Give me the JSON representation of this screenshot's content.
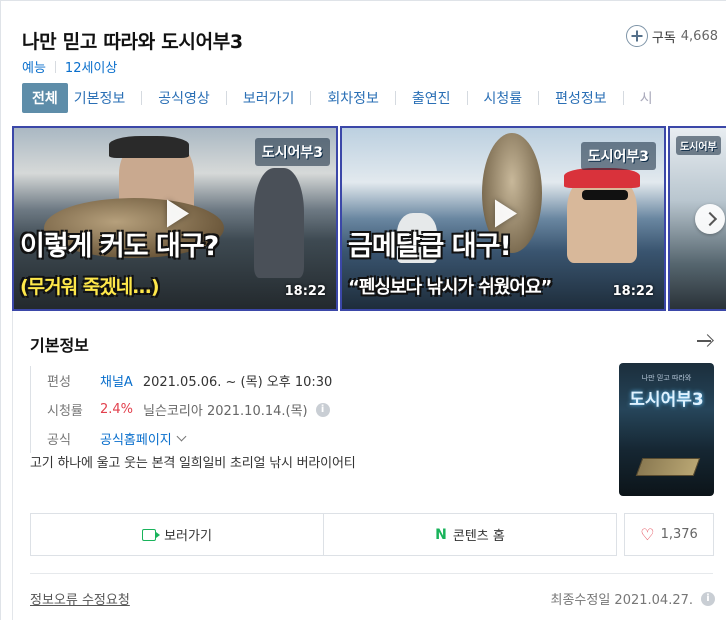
{
  "header": {
    "title": "나만 믿고 따라와 도시어부3",
    "genre": "예능",
    "age_rating": "12세이상",
    "subscribe_label": "구독",
    "subscribe_count": "4,668"
  },
  "tabs": [
    {
      "label": "전체",
      "active": true
    },
    {
      "label": "기본정보"
    },
    {
      "label": "공식영상"
    },
    {
      "label": "보러가기"
    },
    {
      "label": "회차정보"
    },
    {
      "label": "출연진"
    },
    {
      "label": "시청률"
    },
    {
      "label": "편성정보"
    },
    {
      "label": "시"
    }
  ],
  "videos": [
    {
      "caption_main": "이렇게 커도 대구?",
      "caption_sub": "(무거워 죽겠네...)",
      "logo": "도시어부3",
      "duration": "18:22"
    },
    {
      "caption_main": "금메달급 대구!",
      "caption_sub": "“펜싱보다 낚시가 쉬웠어요”",
      "logo": "도시어부3",
      "duration": "18:22"
    },
    {
      "logo": "도시어부"
    }
  ],
  "info": {
    "section_title": "기본정보",
    "schedule_label": "편성",
    "channel": "채널A",
    "schedule": "2021.05.06. ~  (목) 오후 10:30",
    "ratings_label": "시청률",
    "rating_value": "2.4%",
    "rating_source": "닐슨코리아 2021.10.14.(목)",
    "official_label": "공식",
    "official_link": "공식홈페이지",
    "description": "고기 하나에 울고 웃는 본격 일희일비 초리얼 낚시 버라이어티",
    "poster_title": "도시어부3",
    "poster_sub": "나만 믿고 따라와"
  },
  "actions": {
    "watch_label": "보러가기",
    "content_home_label": "콘텐츠 홈",
    "content_home_icon": "N",
    "like_count": "1,376"
  },
  "footer": {
    "report_label": "정보오류 수정요청",
    "updated_label": "최종수정일 2021.04.27."
  },
  "colors": {
    "accent_blue": "#0a6fcc",
    "active_tab": "#5e8da9",
    "naver_green": "#19b35b",
    "rating_red": "#e2404d"
  }
}
